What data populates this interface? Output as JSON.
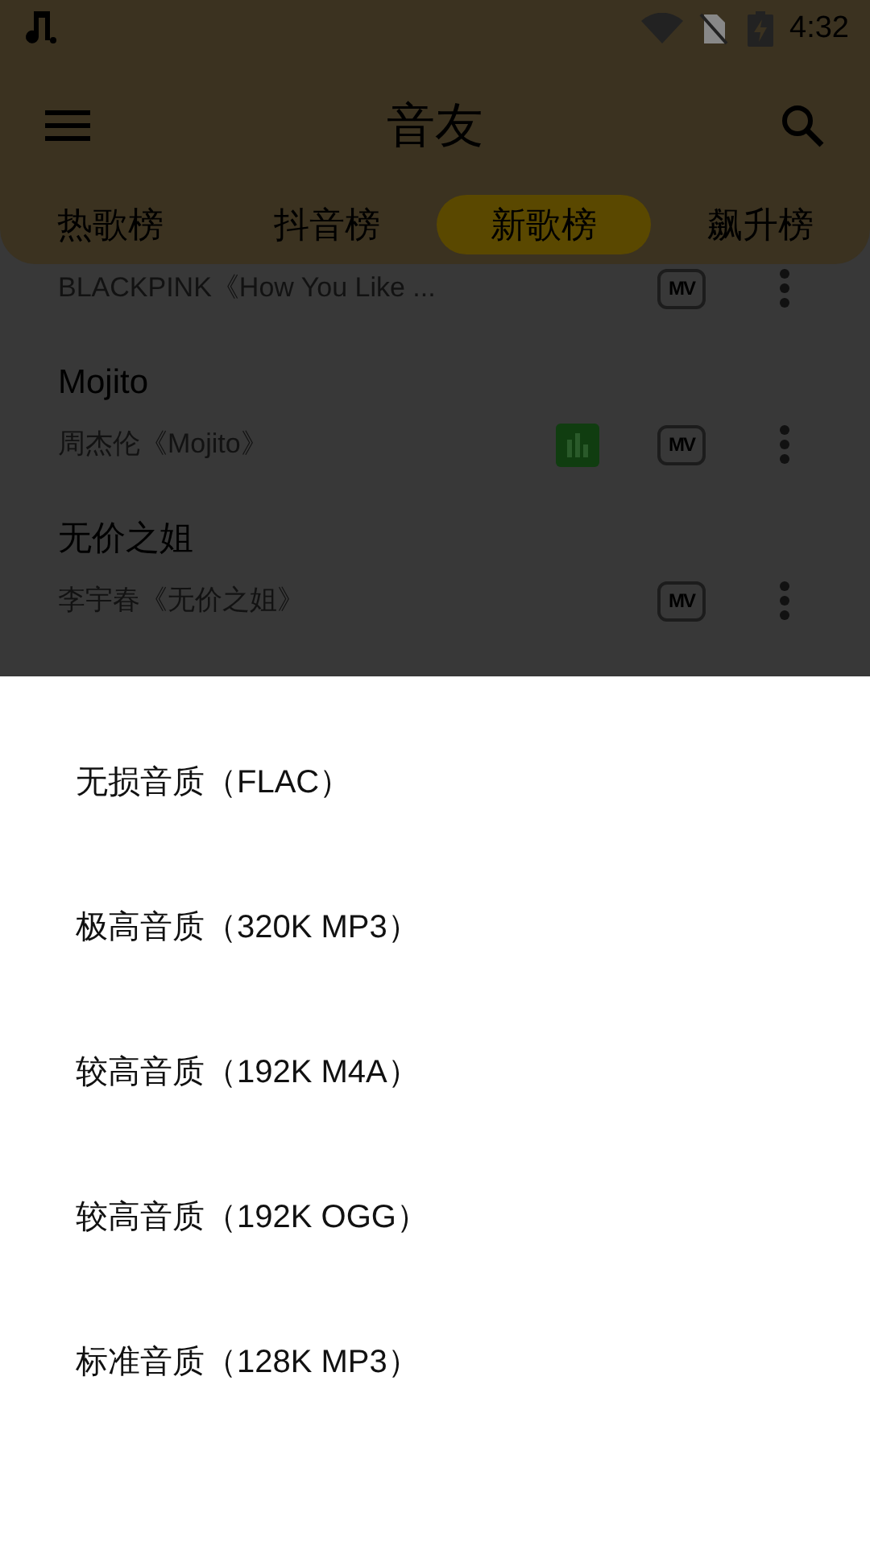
{
  "status_bar": {
    "time": "4:32"
  },
  "app_bar": {
    "title": "音友"
  },
  "tabs": [
    {
      "label": "热歌榜",
      "selected": false
    },
    {
      "label": "抖音榜",
      "selected": false
    },
    {
      "label": "新歌榜",
      "selected": true
    },
    {
      "label": "飙升榜",
      "selected": false
    }
  ],
  "songs": [
    {
      "subtitle": "BLACKPINK《How You Like ...",
      "playing": false,
      "mv": "MV"
    },
    {
      "title": "Mojito",
      "subtitle": "周杰伦《Mojito》",
      "playing": true,
      "mv": "MV"
    },
    {
      "title": "无价之姐",
      "subtitle": "李宇春《无价之姐》",
      "playing": false,
      "mv": "MV"
    }
  ],
  "quality_sheet": {
    "options": [
      "无损音质（FLAC）",
      "极高音质（320K MP3）",
      "较高音质（192K M4A）",
      "较高音质（192K OGG）",
      "标准音质（128K MP3）"
    ]
  }
}
